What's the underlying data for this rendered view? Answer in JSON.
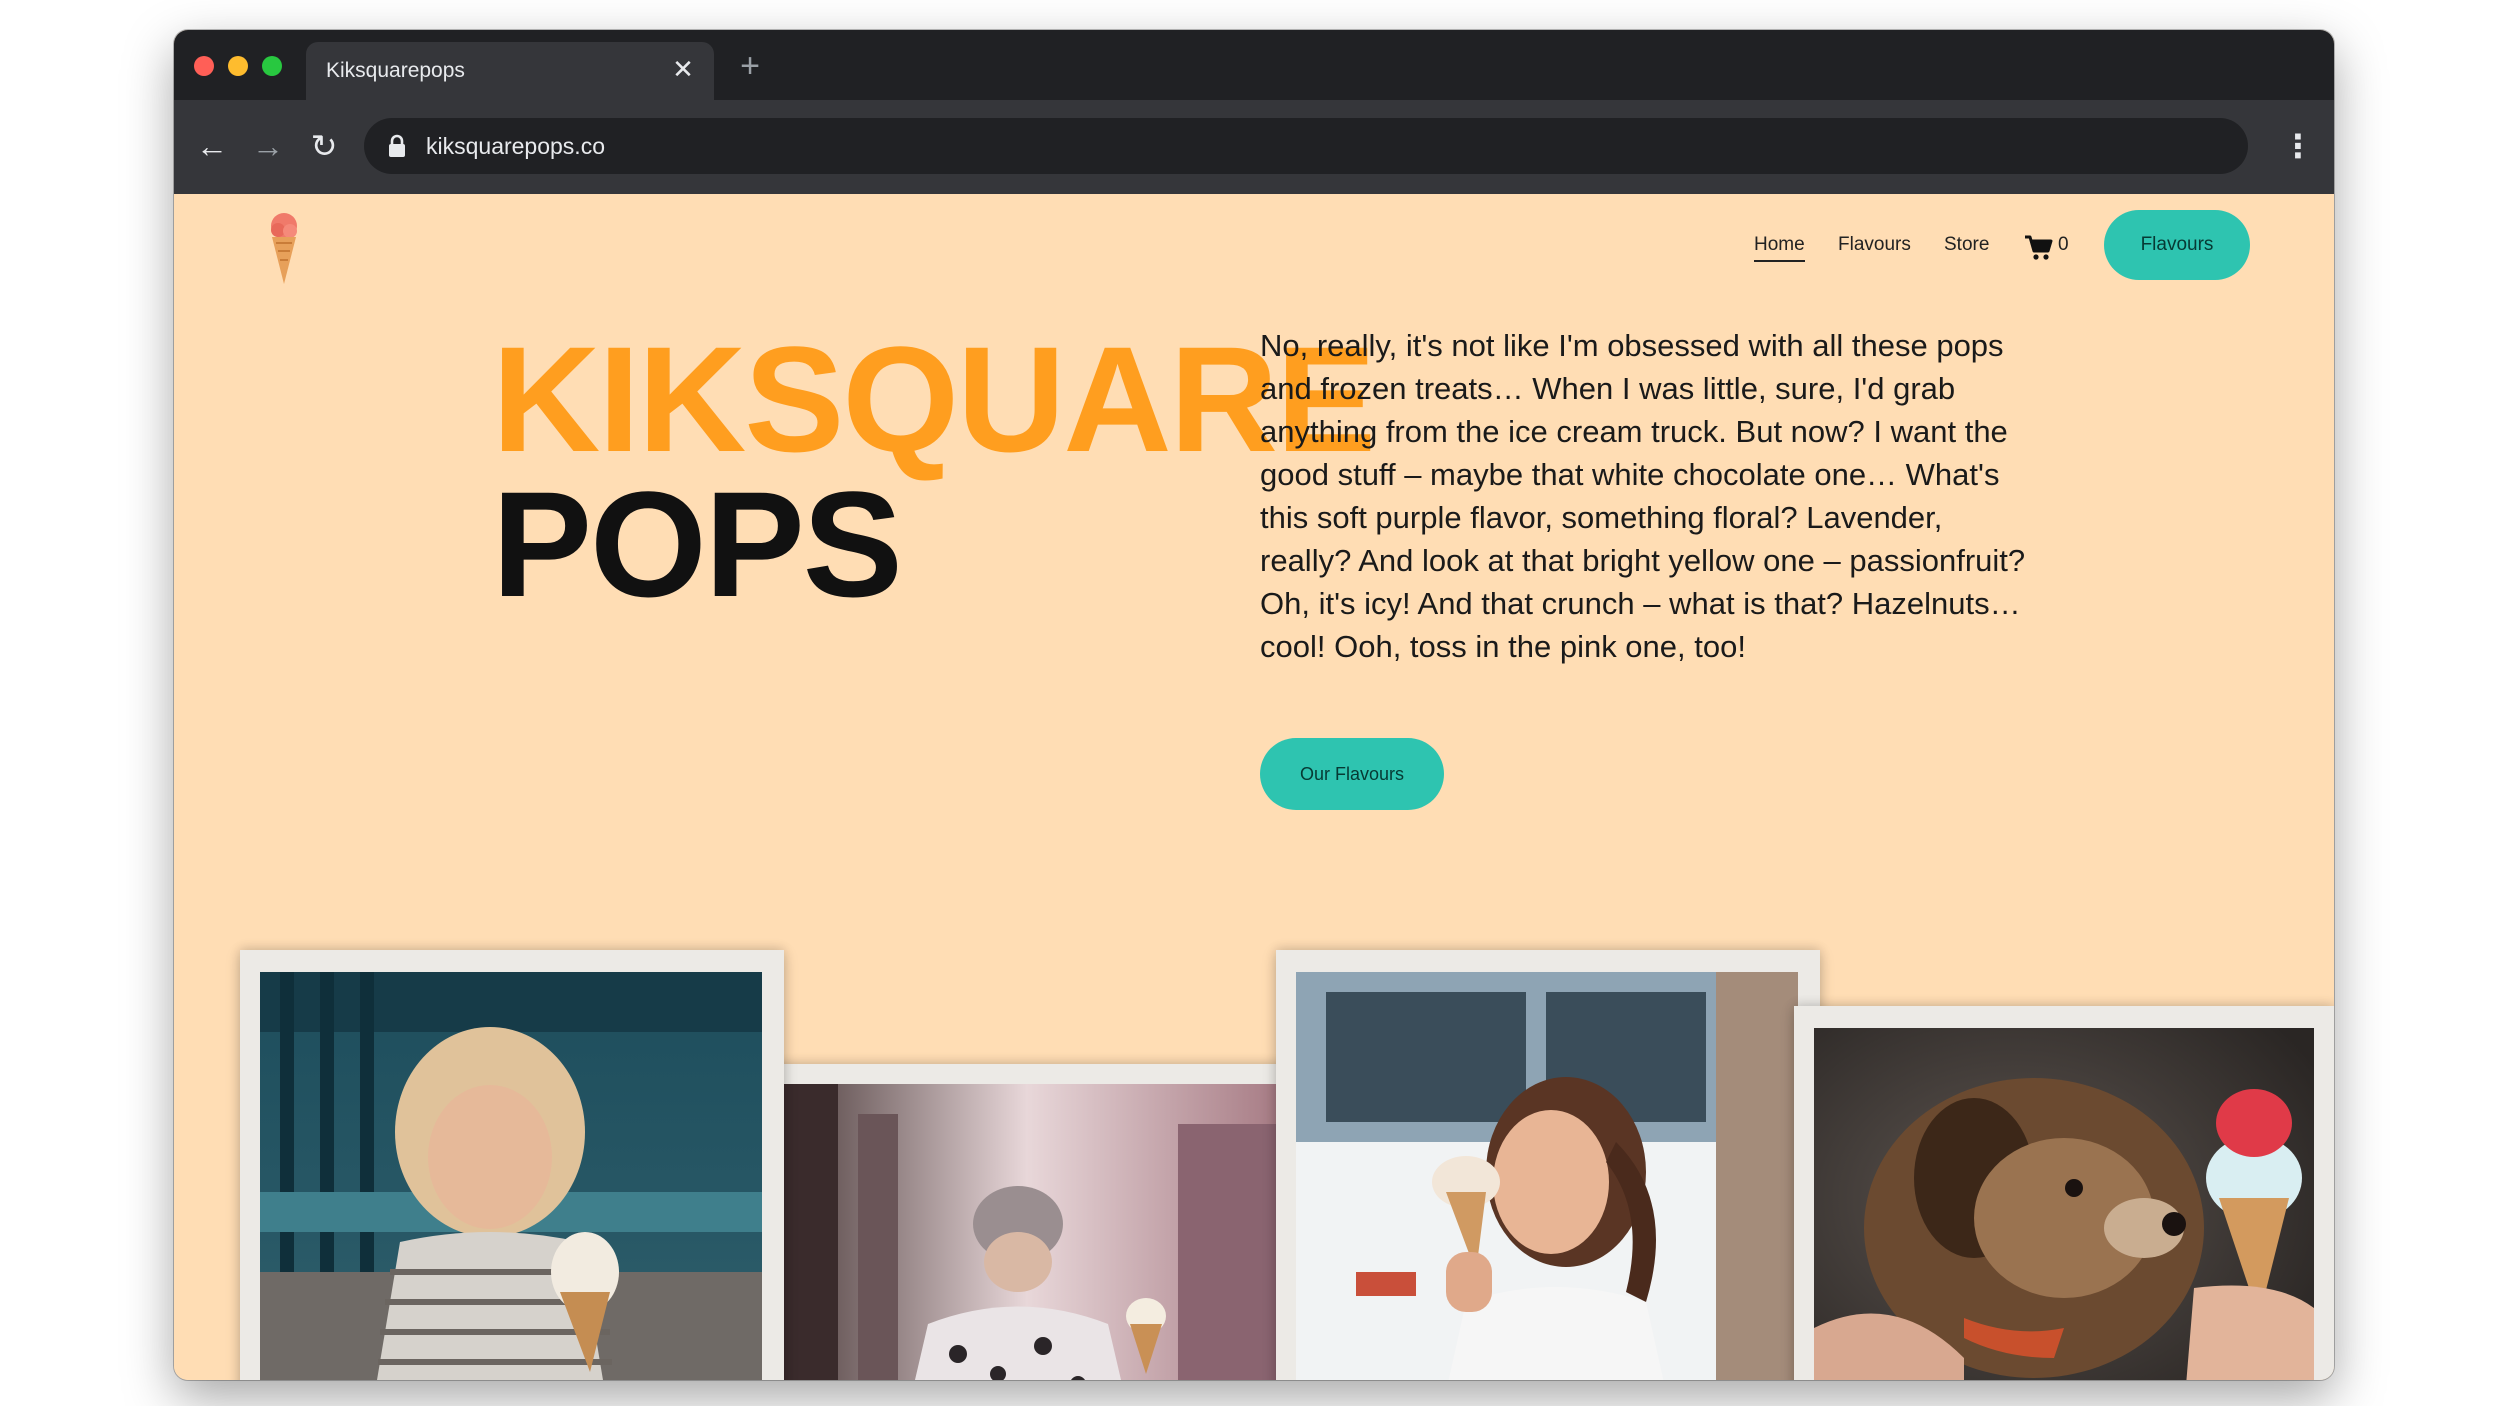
{
  "browser": {
    "tab_title": "Kiksquarepops",
    "url": "kiksquarepops.co"
  },
  "nav": {
    "links": [
      "Home",
      "Flavours",
      "Store"
    ],
    "cart_count": "0",
    "cta_label": "Flavours"
  },
  "hero": {
    "title_line1": "KIKSQUARE",
    "title_line2": "POPS",
    "intro": "No, really, it's not like I'm obsessed with all these pops and frozen treats… When I was little, sure, I'd grab anything from the ice cream truck. But now? I want the good stuff – maybe that white chocolate one… What's this soft purple flavor, something floral? Lavender, really? And look at that bright yellow one – passionfruit? Oh, it's icy! And that crunch – what is that? Hazelnuts… cool! Ooh, toss in the pink one, too!",
    "button_label": "Our Flavours"
  },
  "colors": {
    "page_background": "#FFDDB4",
    "accent_orange": "#FF9E1F",
    "accent_teal": "#2EC4B0"
  },
  "icons": {
    "logo": "ice-cream-cone-icon",
    "cart": "shopping-cart-icon",
    "lock": "lock-icon"
  }
}
